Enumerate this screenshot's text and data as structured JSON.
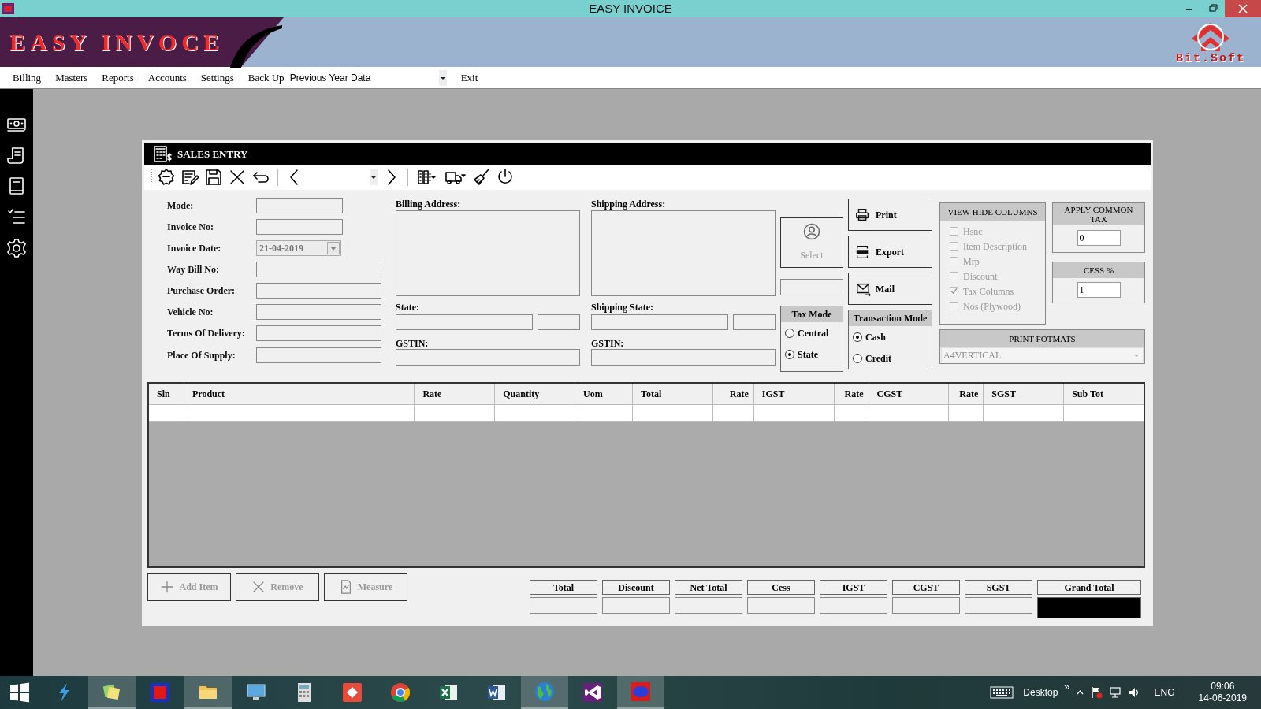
{
  "window": {
    "title": "EASY INVOICE"
  },
  "banner": {
    "title": "EASY INVOCE",
    "logo_text": "Bit.Soft"
  },
  "menu": [
    {
      "label": "Billing",
      "kind": "item"
    },
    {
      "label": "Masters",
      "kind": "item"
    },
    {
      "label": "Reports",
      "kind": "item"
    },
    {
      "label": "Accounts",
      "kind": "item"
    },
    {
      "label": "Settings",
      "kind": "item"
    },
    {
      "label": "Back Up",
      "kind": "item"
    },
    {
      "label": "Previous Year Data",
      "kind": "combo"
    },
    {
      "label": "Exit",
      "kind": "item"
    }
  ],
  "sidebar": [
    {
      "kind": "cash"
    },
    {
      "kind": "receipt"
    },
    {
      "kind": "book"
    },
    {
      "kind": "checklist"
    },
    {
      "kind": "gear"
    }
  ],
  "dialog": {
    "title": "SALES ENTRY"
  },
  "toolbar": [
    {
      "kind": "badge"
    },
    {
      "kind": "edit"
    },
    {
      "kind": "save"
    },
    {
      "kind": "close"
    },
    {
      "kind": "undo"
    },
    {
      "kind": "sep"
    },
    {
      "kind": "prev"
    },
    {
      "kind": "combo"
    },
    {
      "kind": "next"
    },
    {
      "kind": "sep"
    },
    {
      "kind": "columns"
    },
    {
      "kind": "truck"
    },
    {
      "kind": "brush"
    },
    {
      "kind": "power"
    }
  ],
  "fields": [
    {
      "label": "Mode:",
      "kind": "short"
    },
    {
      "label": "Invoice No:",
      "kind": "short"
    },
    {
      "label": "Invoice Date:",
      "kind": "date",
      "value": "21-04-2019",
      "disabled": true
    },
    {
      "label": "Way Bill No:",
      "kind": "long"
    },
    {
      "label": "Purchase Order:",
      "kind": "long"
    },
    {
      "label": "Vehicle No:",
      "kind": "long"
    },
    {
      "label": "Terms Of Delivery:",
      "kind": "long"
    },
    {
      "label": "Place Of Supply:",
      "kind": "long"
    }
  ],
  "billing": {
    "address_label": "Billing Address:",
    "state_label": "State:",
    "gstin_label": "GSTIN:"
  },
  "shipping": {
    "address_label": "Shipping Address:",
    "state_label": "Shipping State:",
    "gstin_label": "GSTIN:"
  },
  "select_button": {
    "label": "Select",
    "disabled": true
  },
  "tax_mode": {
    "title": "Tax Mode",
    "options": [
      {
        "label": "Central",
        "selected": false
      },
      {
        "label": "State",
        "selected": true
      }
    ]
  },
  "actions": [
    {
      "label": "Print",
      "kind": "print"
    },
    {
      "label": "Export",
      "kind": "pdf"
    },
    {
      "label": "Mail",
      "kind": "mail"
    }
  ],
  "transaction_mode": {
    "title": "Transaction Mode",
    "options": [
      {
        "label": "Cash",
        "selected": true
      },
      {
        "label": "Credit",
        "selected": false
      }
    ]
  },
  "view_hide_columns": {
    "title": "VIEW HIDE COLUMNS",
    "items": [
      {
        "label": "Hsnc",
        "checked": false
      },
      {
        "label": "Item Description",
        "checked": false
      },
      {
        "label": "Mrp",
        "checked": false
      },
      {
        "label": "Discount",
        "checked": false
      },
      {
        "label": "Tax Columns",
        "checked": true
      },
      {
        "label": "Nos (Plywood)",
        "checked": false
      }
    ]
  },
  "common_tax": {
    "title": "APPLY COMMON TAX",
    "value": "0"
  },
  "cess": {
    "title": "CESS %",
    "value": "1"
  },
  "print_formats": {
    "title": "PRINT FOTMATS",
    "value": "A4VERTICAL"
  },
  "table": {
    "columns": [
      "Sln",
      "Product",
      "Rate",
      "Quantity",
      "Uom",
      "Total",
      "Rate",
      "IGST",
      "Rate",
      "CGST",
      "Rate",
      "SGST",
      "Sub Tot"
    ]
  },
  "item_buttons": [
    {
      "label": "Add Item",
      "kind": "plus",
      "disabled": true
    },
    {
      "label": "Remove",
      "kind": "x",
      "disabled": true
    },
    {
      "label": "Measure",
      "kind": "doc",
      "disabled": true
    }
  ],
  "totals": [
    {
      "label": "Total",
      "highlight": false
    },
    {
      "label": "Discount",
      "highlight": false
    },
    {
      "label": "Net Total",
      "highlight": false
    },
    {
      "label": "Cess",
      "highlight": false
    },
    {
      "label": "IGST",
      "highlight": false
    },
    {
      "label": "CGST",
      "highlight": false
    },
    {
      "label": "SGST",
      "highlight": false
    },
    {
      "label": "Grand Total",
      "highlight": true
    }
  ],
  "taskbar": {
    "apps": [
      {
        "kind": "bolt",
        "running": false
      },
      {
        "kind": "notes",
        "running": true
      },
      {
        "kind": "dsquare",
        "running": false
      },
      {
        "kind": "folder",
        "running": true
      },
      {
        "kind": "monitor",
        "running": false
      },
      {
        "kind": "calculator",
        "running": false
      },
      {
        "kind": "diamond",
        "running": false
      },
      {
        "kind": "wheel",
        "running": false
      },
      {
        "kind": "sheet",
        "running": false
      },
      {
        "kind": "doc",
        "running": false
      },
      {
        "kind": "globe",
        "running": true
      },
      {
        "kind": "vs",
        "running": false
      },
      {
        "kind": "redapp",
        "running": true
      }
    ],
    "desktop_label": "Desktop",
    "chevron": "»",
    "language": "ENG",
    "time": "09:06",
    "date": "14-06-2019"
  }
}
